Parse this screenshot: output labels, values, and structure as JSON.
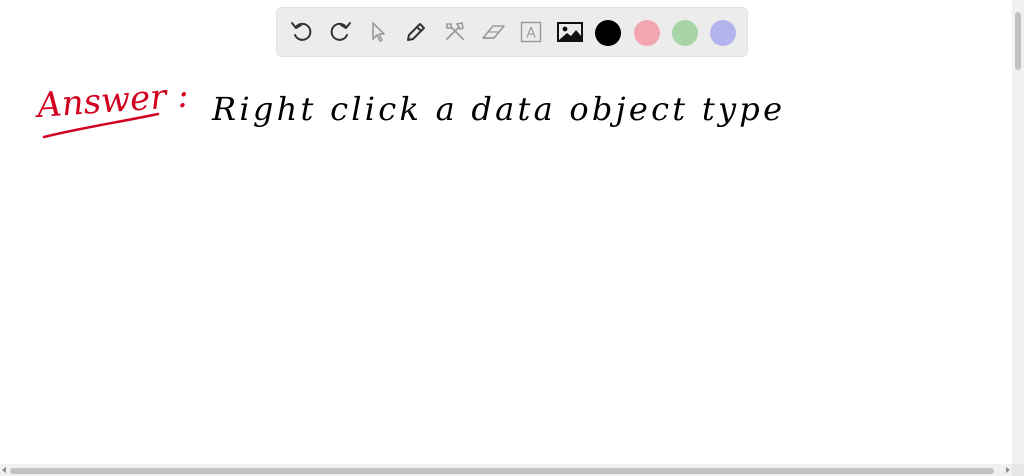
{
  "toolbar": {
    "tools": [
      {
        "name": "undo-icon"
      },
      {
        "name": "redo-icon"
      },
      {
        "name": "select-pointer-icon"
      },
      {
        "name": "pen-icon"
      },
      {
        "name": "tools-icon"
      },
      {
        "name": "eraser-icon"
      },
      {
        "name": "text-icon",
        "glyph": "A"
      },
      {
        "name": "image-icon"
      }
    ],
    "colors": {
      "black": "#000000",
      "red": "#f2a6ae",
      "green": "#a8d5a8",
      "purple": "#b3b3ee"
    }
  },
  "canvas": {
    "label": "Answer :",
    "label_color": "#d1001f",
    "text": "Right click a data object type",
    "text_color": "#000000"
  }
}
